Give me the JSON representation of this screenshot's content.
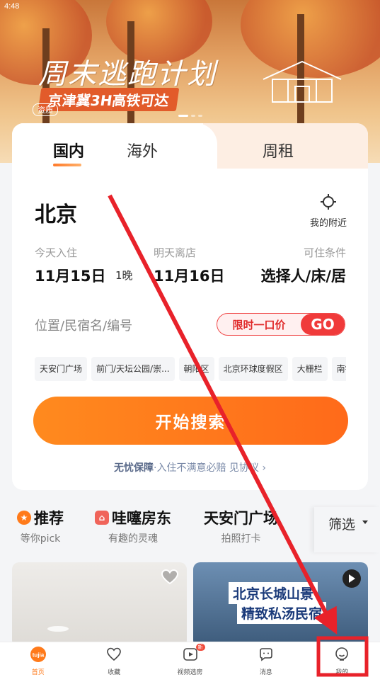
{
  "status_bar": {
    "time": "4:48"
  },
  "banner": {
    "title": "周末逃跑计划",
    "subtitle": "京津冀3H高铁可达",
    "ad_label": "资质"
  },
  "tabs": [
    {
      "label": "国内",
      "active": true
    },
    {
      "label": "海外",
      "active": false
    },
    {
      "label": "周租",
      "active": false
    }
  ],
  "search": {
    "city": "北京",
    "nearby_label": "我的附近",
    "checkin_label": "今天入住",
    "checkin_date": "11月15日",
    "nights": "1晚",
    "checkout_label": "明天离店",
    "checkout_date": "11月16日",
    "conditions_label": "可住条件",
    "conditions_value": "选择人/床/居",
    "keyword_placeholder": "位置/民宿名/编号",
    "promo_text": "限时一口价",
    "promo_go": "GO",
    "hot_tags": [
      "天安门广场",
      "前门/天坛公园/崇...",
      "朝阳区",
      "北京环球度假区",
      "大栅栏",
      "南锣"
    ],
    "button_label": "开始搜索",
    "guarantee_main": "无忧保障",
    "guarantee_rest": "·入住不满意必赔",
    "guarantee_link": "见协议 ›"
  },
  "categories": [
    {
      "title": "推荐",
      "sub": "等你pick",
      "icon": "star-icon",
      "color": "#ff7a1a"
    },
    {
      "title": "哇噻房东",
      "sub": "有趣的灵魂",
      "icon": "host-icon",
      "color": "#f0645a"
    },
    {
      "title": "天安门广场",
      "sub": "拍照打卡",
      "icon": "",
      "color": ""
    }
  ],
  "filter_label": "筛选",
  "listings": [
    {
      "overlay": []
    },
    {
      "overlay": [
        "北京长城山景",
        "精致私汤民宿"
      ]
    }
  ],
  "nav": [
    {
      "label": "首页",
      "icon": "home-logo-icon",
      "active": true
    },
    {
      "label": "收藏",
      "icon": "heart-icon",
      "active": false
    },
    {
      "label": "视频选房",
      "icon": "video-icon",
      "active": false,
      "badge": "新"
    },
    {
      "label": "消息",
      "icon": "message-icon",
      "active": false
    },
    {
      "label": "我的",
      "icon": "profile-icon",
      "active": false
    }
  ],
  "colors": {
    "accent": "#ff7a1a",
    "annotation": "#e8222a",
    "promo": "#f03a3a"
  }
}
